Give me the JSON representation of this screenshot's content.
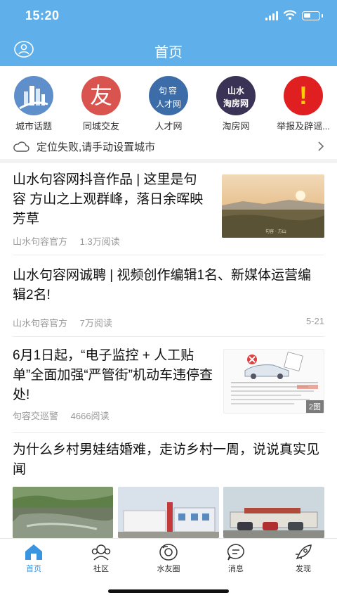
{
  "status_bar": {
    "time": "15:20"
  },
  "nav": {
    "title": "首页",
    "user_icon": "user-icon"
  },
  "quick_links": [
    {
      "label": "城市话题",
      "icon": "city-topic-icon"
    },
    {
      "label": "同城交友",
      "icon": "friend-icon",
      "glyph": "友"
    },
    {
      "label": "人才网",
      "icon": "talent-net-icon",
      "glyph_top": "句容",
      "glyph_bottom": "人才网"
    },
    {
      "label": "淘房网",
      "icon": "house-net-icon",
      "glyph_top": "山水",
      "glyph_bottom": "淘房网"
    },
    {
      "label": "举报及辟谣...",
      "icon": "report-icon",
      "glyph": "!"
    }
  ],
  "location": {
    "text": "定位失败,请手动设置城市"
  },
  "articles": [
    {
      "title": "山水句容网抖音作品 | 这里是句容 方山之上观群峰，落日余晖映芳草",
      "source": "山水句容官方",
      "reads": "1.3万阅读",
      "thumb_caption": "句容 · 方山"
    },
    {
      "title": "山水句容网诚聘 | 视频创作编辑1名、新媒体运营编辑2名!",
      "source": "山水句容官方",
      "reads": "7万阅读",
      "date": "5-21"
    },
    {
      "title": "6月1日起，“电子监控 + 人工贴单”全面加强“严管街”机动车违停查处!",
      "source": "句容交巡警",
      "reads": "4666阅读",
      "image_count": "2图"
    },
    {
      "title": "为什么乡村男娃结婚难，走访乡村一周，说说真实见闻"
    }
  ],
  "tabs": [
    {
      "label": "首页",
      "icon": "home-icon",
      "active": true
    },
    {
      "label": "社区",
      "icon": "community-icon"
    },
    {
      "label": "水友圈",
      "icon": "friends-circle-icon"
    },
    {
      "label": "消息",
      "icon": "message-icon"
    },
    {
      "label": "发现",
      "icon": "discover-icon"
    }
  ],
  "colors": {
    "brand": "#5fb0ea",
    "tab_active": "#3a94e0"
  }
}
